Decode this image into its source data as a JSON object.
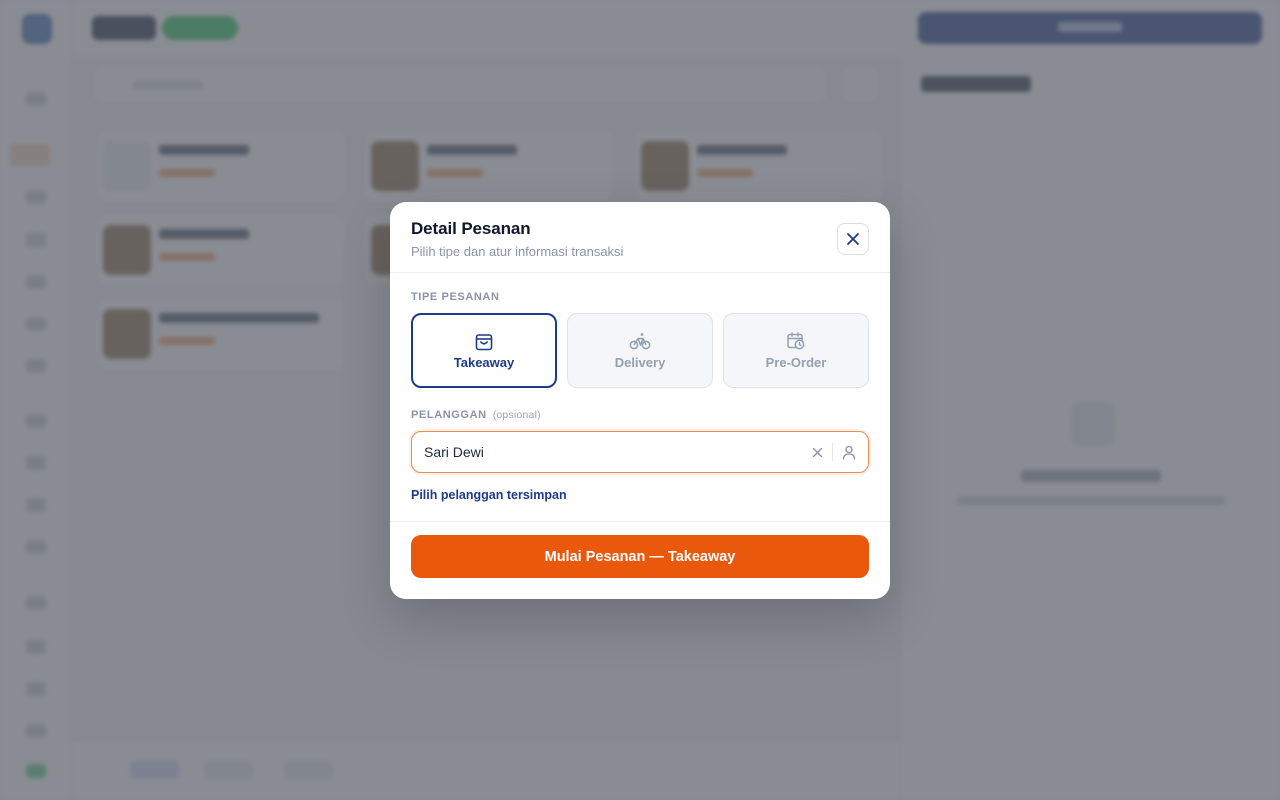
{
  "modal": {
    "title": "Detail Pesanan",
    "subtitle": "Pilih tipe dan atur informasi transaksi",
    "close_icon": "close-icon"
  },
  "order_type": {
    "label": "TIPE PESANAN",
    "selected": "Takeaway",
    "options": [
      {
        "label": "Takeaway",
        "icon": "shopping-bag-icon",
        "active": true
      },
      {
        "label": "Delivery",
        "icon": "bicycle-icon",
        "active": false
      },
      {
        "label": "Pre-Order",
        "icon": "calendar-clock-icon",
        "active": false
      }
    ]
  },
  "customer": {
    "label": "PELANGGAN",
    "optional_note": "(opsional)",
    "value": "Sari Dewi",
    "clear_icon": "clear-icon",
    "user_icon": "user-icon",
    "saved_link": "Pilih pelanggan tersimpan"
  },
  "footer": {
    "start_button": "Mulai Pesanan — Takeaway"
  },
  "colors": {
    "accent_navy": "#1e3a8a",
    "primary_orange": "#ea580c",
    "input_focus_border": "#f08a4b",
    "scrim": "#5c6068"
  }
}
